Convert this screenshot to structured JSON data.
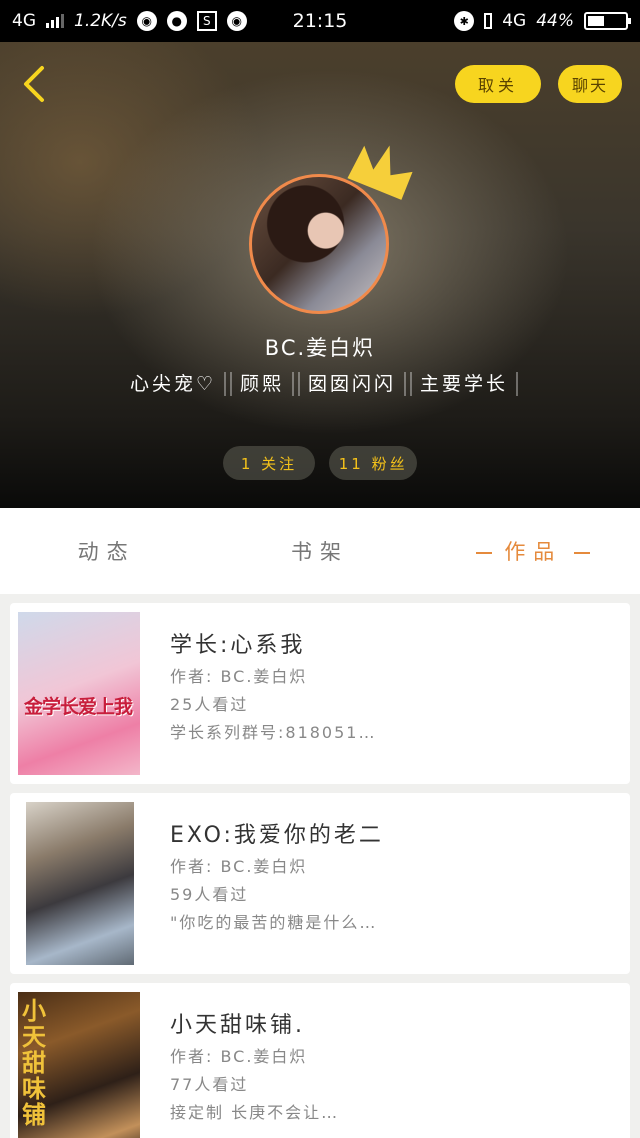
{
  "status_bar": {
    "network": "4G",
    "speed": "1.2K/s",
    "time": "21:15",
    "mobile_data": "4G",
    "battery": "44%",
    "battery_level": 0.44
  },
  "header": {
    "unfollow_label": "取关",
    "chat_label": "聊天"
  },
  "profile": {
    "username": "BC.姜白炽",
    "tags": [
      "心尖宠♡",
      "顾熙",
      "囡囡闪闪",
      "主要学长"
    ],
    "following": "1 关注",
    "followers": "11 粉丝"
  },
  "tabs": [
    {
      "label": "动态"
    },
    {
      "label": "书架"
    },
    {
      "label": "作品"
    }
  ],
  "works": [
    {
      "title": "学长:心系我",
      "author": "作者: BC.姜白炽",
      "views": "25人看过",
      "desc": "学长系列群号:818051…",
      "cover_text": "金学长爱上我"
    },
    {
      "title": "EXO:我爱你的老二",
      "author": "作者: BC.姜白炽",
      "views": "59人看过",
      "desc": "\"你吃的最苦的糖是什么…"
    },
    {
      "title": "小天甜味铺.",
      "author": "作者: BC.姜白炽",
      "views": "77人看过",
      "desc": "接定制 长庚不会让…",
      "cover_text": "小天甜味铺"
    }
  ]
}
